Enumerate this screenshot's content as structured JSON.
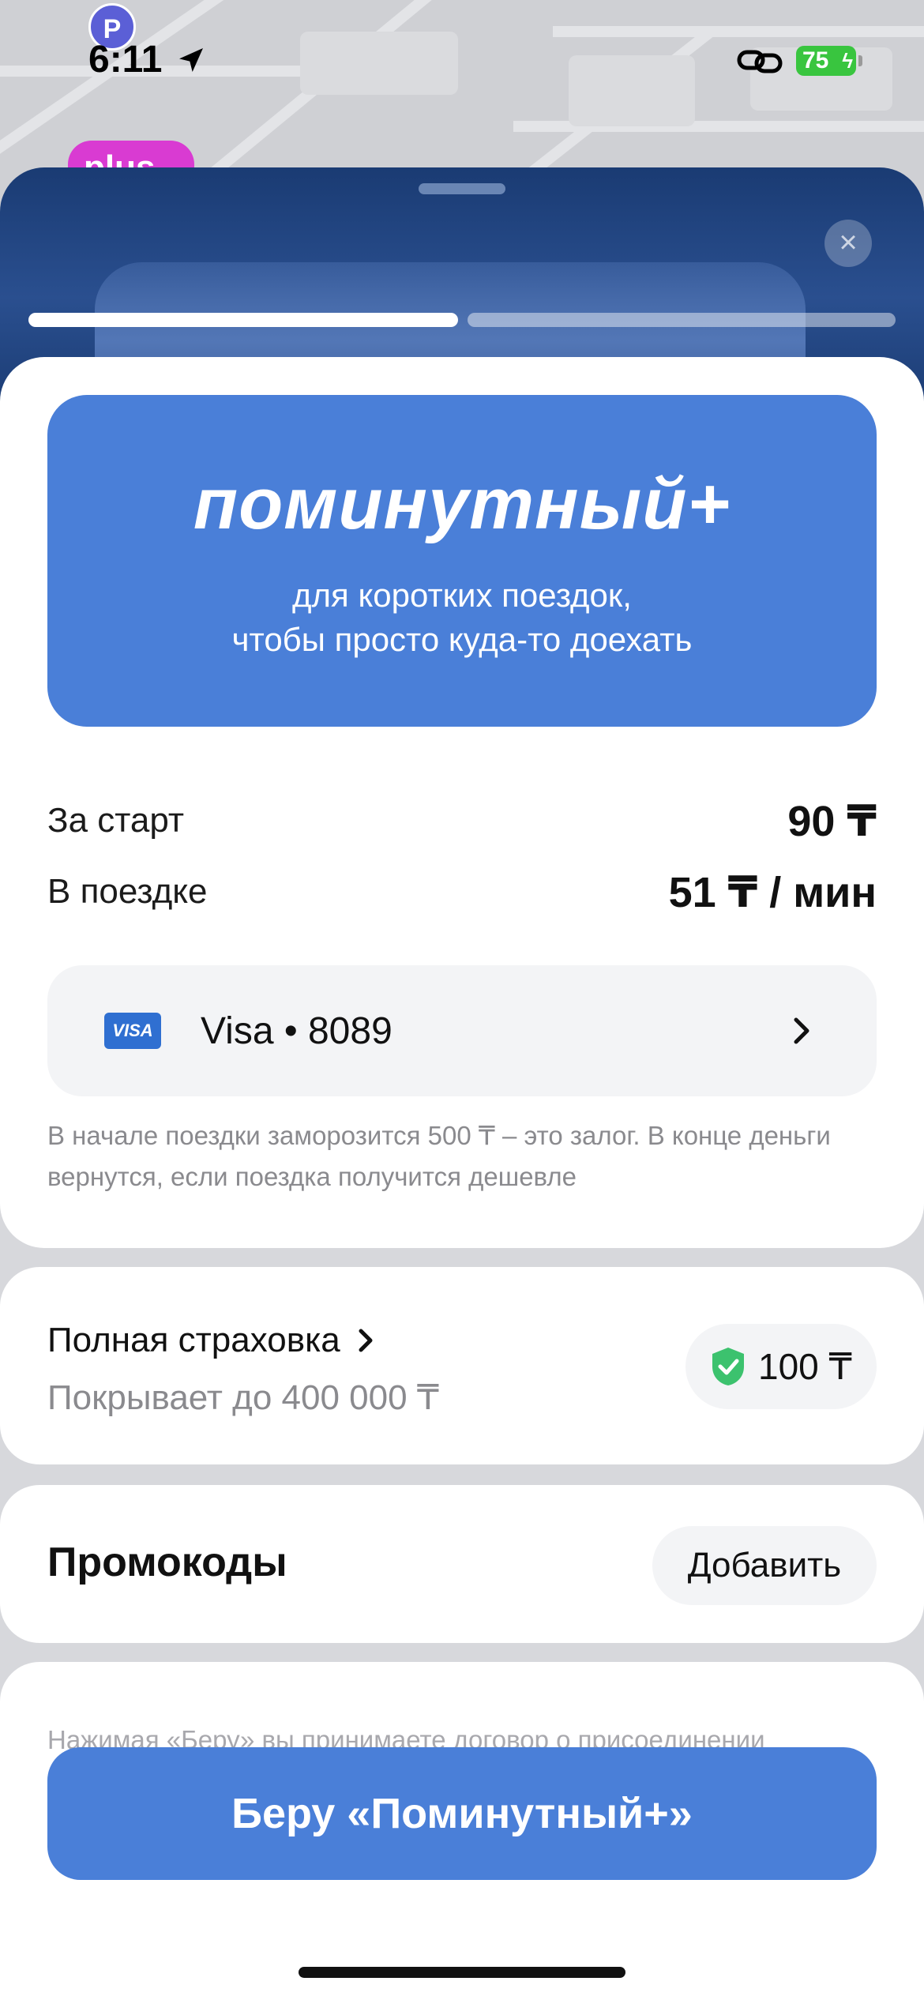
{
  "status_bar": {
    "time": "6:11",
    "battery": "75"
  },
  "map": {
    "parking_label": "P",
    "plus_label": "plus"
  },
  "tariff": {
    "title": "поминутный+",
    "subtitle_line1": "для коротких поездок,",
    "subtitle_line2": "чтобы просто куда-то доехать"
  },
  "pricing": {
    "start_label": "За старт",
    "start_value": "90 ₸",
    "ride_label": "В поездке",
    "ride_value": "51 ₸ / мин"
  },
  "payment": {
    "card_brand": "VISA",
    "card_label": "Visa • 8089"
  },
  "deposit_note": "В начале поездки заморозится 500 ₸ – это залог. В конце деньги вернутся, если поездка получится дешевле",
  "insurance": {
    "title": "Полная страховка",
    "subtitle": "Покрывает до 400 000 ₸",
    "price": "100 ₸"
  },
  "promo": {
    "title": "Промокоды",
    "add_label": "Добавить"
  },
  "legal_text": "Нажимая «Беру» вы принимаете договор о присоединении",
  "cta_label": "Беру «Поминутный+»",
  "colors": {
    "accent": "#4a7fd8",
    "header_dark": "#1a3b73",
    "battery_green": "#39c53f",
    "shield_green": "#3cc26e"
  }
}
